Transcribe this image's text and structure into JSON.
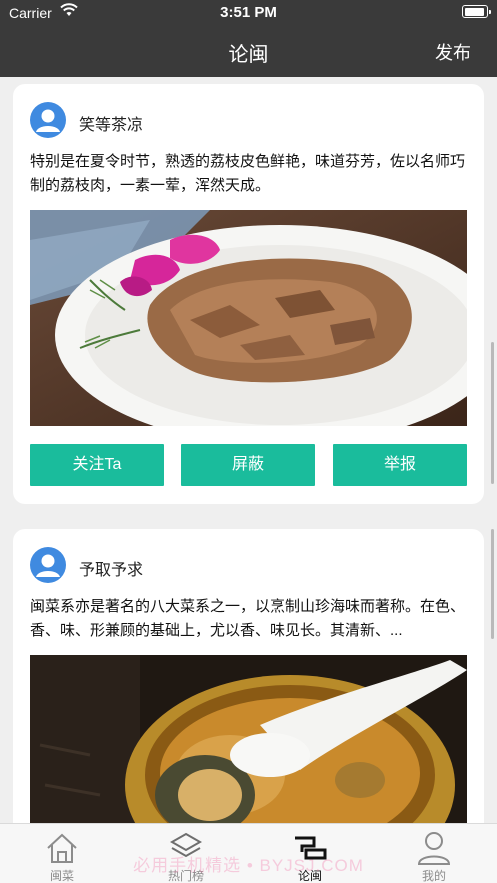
{
  "status_bar": {
    "carrier": "Carrier",
    "time": "3:51 PM"
  },
  "nav": {
    "title": "论闽",
    "publish_label": "发布"
  },
  "posts": [
    {
      "username": "笑等茶凉",
      "text": "特别是在夏令时节，熟透的荔枝皮色鲜艳，味道芬芳，佐以名师巧制的荔枝肉，一素一荤，浑然天成。",
      "actions": [
        "关注Ta",
        "屏蔽",
        "举报"
      ]
    },
    {
      "username": "予取予求",
      "text": "闽菜系亦是著名的八大菜系之一，以烹制山珍海味而著称。在色、香、味、形兼顾的基础上，尤以香、味见长。其清新、..."
    }
  ],
  "tabs": [
    {
      "label": "闽菜",
      "icon": "home-icon"
    },
    {
      "label": "热门榜",
      "icon": "layers-icon"
    },
    {
      "label": "论闽",
      "icon": "forum-icon"
    },
    {
      "label": "我的",
      "icon": "person-icon"
    }
  ],
  "watermark": "必用手机精选 • BYJSJ.COM",
  "colors": {
    "header": "#3a3a3a",
    "accent": "#1abc9c",
    "avatar": "#3f8ae0"
  }
}
